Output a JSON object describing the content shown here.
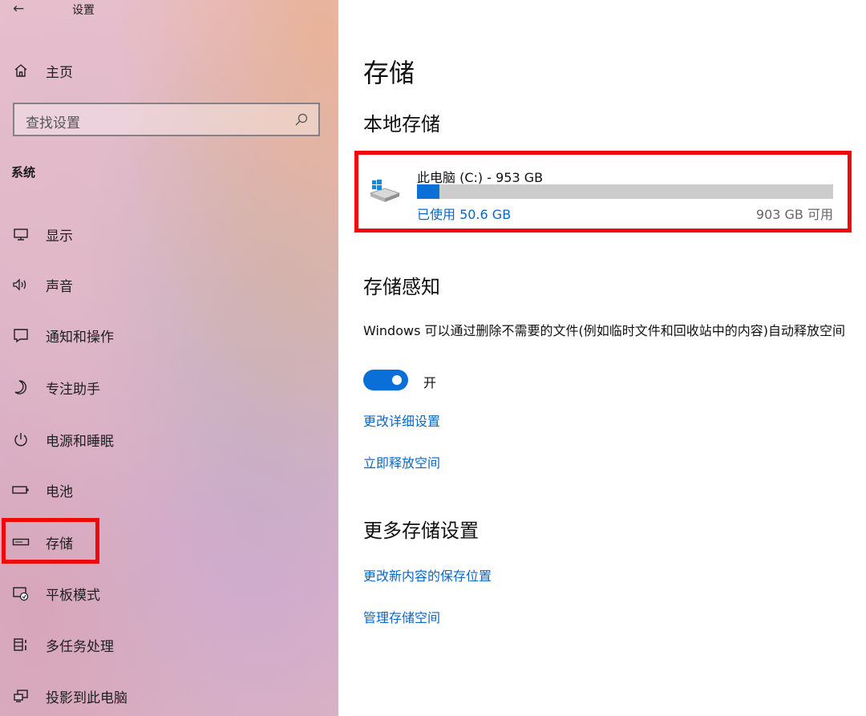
{
  "window": {
    "title": "设置"
  },
  "sidebar": {
    "home_label": "主页",
    "search_placeholder": "查找设置",
    "section": "系统",
    "items": [
      {
        "label": "显示",
        "icon": "monitor-icon"
      },
      {
        "label": "声音",
        "icon": "speaker-icon"
      },
      {
        "label": "通知和操作",
        "icon": "notification-icon"
      },
      {
        "label": "专注助手",
        "icon": "moon-icon"
      },
      {
        "label": "电源和睡眠",
        "icon": "power-icon"
      },
      {
        "label": "电池",
        "icon": "battery-icon"
      },
      {
        "label": "存储",
        "icon": "storage-icon",
        "selected": true
      },
      {
        "label": "平板模式",
        "icon": "tablet-mode-icon"
      },
      {
        "label": "多任务处理",
        "icon": "multitasking-icon"
      },
      {
        "label": "投影到此电脑",
        "icon": "project-icon"
      }
    ]
  },
  "main": {
    "title": "存储",
    "local_storage": {
      "heading": "本地存储",
      "drive_name": "此电脑 (C:) - 953 GB",
      "used_label": "已使用 50.6 GB",
      "free_label": "903 GB 可用",
      "used_fraction": 0.053
    },
    "storage_sense": {
      "heading": "存储感知",
      "description": "Windows 可以通过删除不需要的文件(例如临时文件和回收站中的内容)自动释放空间",
      "toggle_state": "开",
      "links": [
        "更改详细设置",
        "立即释放空间"
      ]
    },
    "more_settings": {
      "heading": "更多存储设置",
      "links": [
        "更改新内容的保存位置",
        "管理存储空间"
      ]
    }
  },
  "colors": {
    "accent": "#0a6fd6",
    "link": "#0b67c4",
    "highlight": "#ee0a0a"
  }
}
